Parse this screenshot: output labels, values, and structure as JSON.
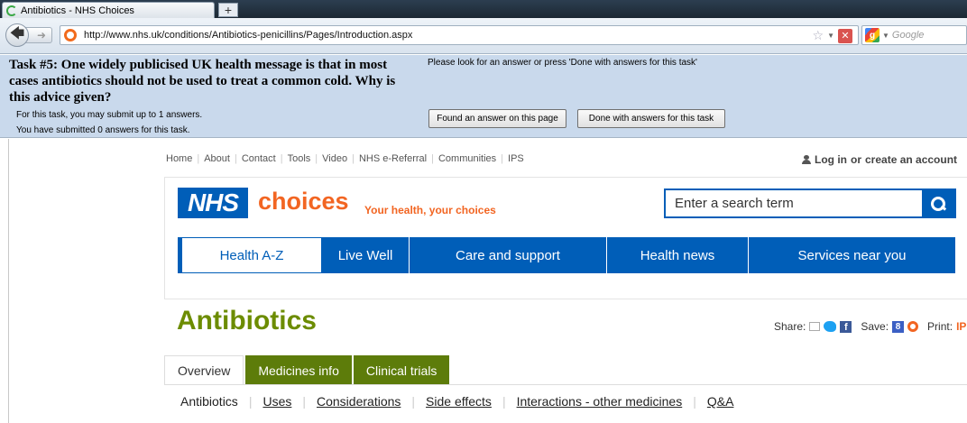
{
  "browser": {
    "tab_title": "Antibiotics - NHS Choices",
    "new_tab_label": "+",
    "url": "http://www.nhs.uk/conditions/Antibiotics-penicillins/Pages/Introduction.aspx",
    "search_placeholder": "Google"
  },
  "task": {
    "question": "Task #5: One widely publicised UK health message is that in most cases antibiotics should not be used to treat a common cold. Why is this advice given?",
    "limit_note": "For this task, you may submit up to 1 answers.",
    "submitted_note": "You have submitted 0 answers for this task.",
    "prompt": "Please look for an answer or press 'Done with answers for this task'",
    "found_button": "Found an answer on this page",
    "done_button": "Done with answers for this task"
  },
  "utility_links": [
    "Home",
    "About",
    "Contact",
    "Tools",
    "Video",
    "NHS e-Referral",
    "Communities",
    "IPS"
  ],
  "account": {
    "login": "Log in",
    "or": "or",
    "create": "create an account"
  },
  "header": {
    "logo": "NHS",
    "brand": "choices",
    "tagline": "Your health, your choices",
    "search_placeholder": "Enter a search term"
  },
  "main_nav": [
    {
      "label": "Health A-Z"
    },
    {
      "label": "Live Well"
    },
    {
      "label": "Care and support"
    },
    {
      "label": "Health news"
    },
    {
      "label": "Services near you"
    }
  ],
  "page": {
    "title": "Antibiotics",
    "share_label": "Share:",
    "save_label": "Save:",
    "print_label": "Print:",
    "print_ip": "IP"
  },
  "tabs": [
    {
      "label": "Overview"
    },
    {
      "label": "Medicines info"
    },
    {
      "label": "Clinical trials"
    }
  ],
  "subnav": [
    "Antibiotics",
    "Uses",
    "Considerations",
    "Side effects",
    "Interactions - other medicines",
    "Q&A"
  ],
  "colors": {
    "nhs_blue": "#005eb8",
    "choices_orange": "#f26522",
    "title_green": "#6c8c00",
    "tab_green": "#5d7c0a",
    "task_panel": "#c9d9ec"
  }
}
